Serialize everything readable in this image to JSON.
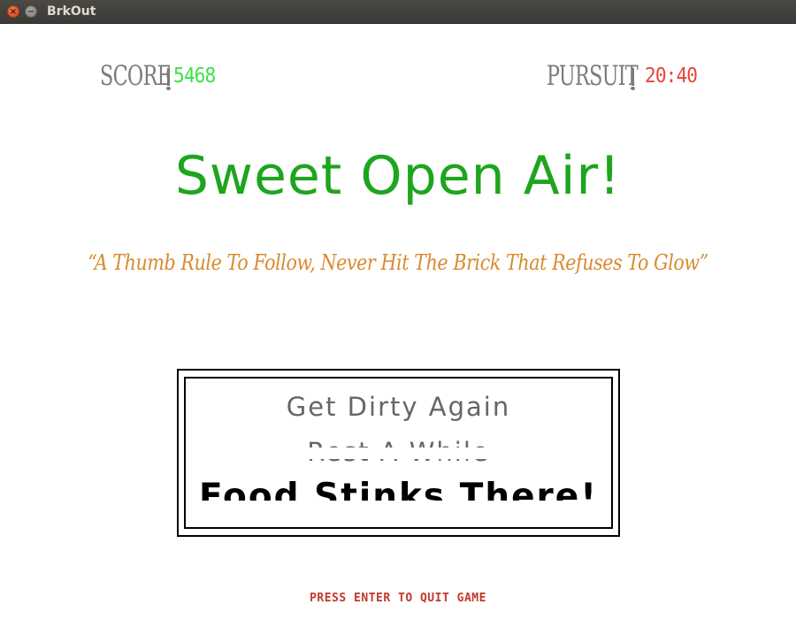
{
  "window": {
    "title": "BrkOut",
    "close_glyph": "×",
    "minimize_glyph": "−"
  },
  "hud": {
    "score_label": "SCORE",
    "score_value": "5468",
    "pursuit_label": "PURSUIT",
    "pursuit_value": "20:40"
  },
  "headline": "Sweet Open Air!",
  "quote": "“A Thumb Rule To Follow, Never Hit The Brick That Refuses To Glow”",
  "menu": {
    "items": [
      "Get Dirty Again",
      "Rest A While",
      "Food Stinks There!"
    ],
    "selected_index": 2
  },
  "footer": "PRESS ENTER TO QUIT GAME",
  "colors": {
    "score_value": "#3ee04a",
    "pursuit_value": "#e8443a",
    "headline": "#1ea51e",
    "quote": "#d98a2e",
    "footer": "#c0392b",
    "hud_label": "#7b7b7b"
  }
}
